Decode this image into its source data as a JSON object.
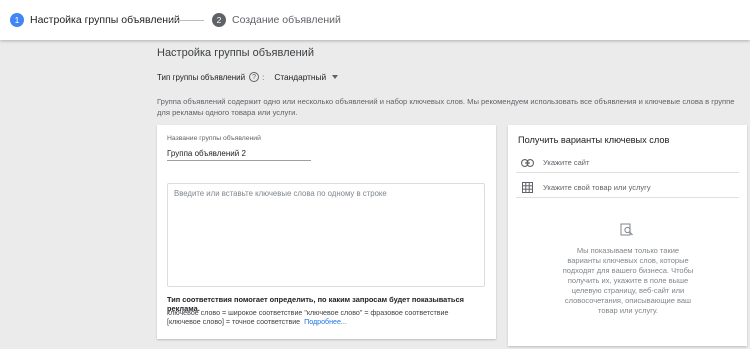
{
  "stepper": {
    "step1_number": "1",
    "step1_label": "Настройка группы объявлений",
    "step2_number": "2",
    "step2_label": "Создание объявлений",
    "active_color": "#4285f4"
  },
  "page": {
    "section_title": "Настройка группы объявлений",
    "type_label": "Тип группы объявлений",
    "type_help_icon": "help-circle-icon",
    "type_colon": ":",
    "type_value": "Стандартный",
    "description": "Группа объявлений содержит одно или несколько объявлений и набор ключевых слов. Мы рекомендуем использовать все объявления и ключевые слова в группе для рекламы одного товара или услуги."
  },
  "ad_group": {
    "name_label": "Название группы объявлений",
    "name_value": "Группа объявлений 2",
    "keywords_placeholder": "Введите или вставьте ключевые слова по одному в строке",
    "keywords_value": "",
    "match_title": "Тип соответствия помогает определить, по каким запросам будет показываться реклама.",
    "match_line1": "ключевое слово = широкое соответствие   \"ключевое слово\" = фразовое соответствие",
    "match_line2": "[ключевое слово] = точное соответствие",
    "more_link": "Подробнее..."
  },
  "keyword_ideas": {
    "title": "Получить варианты ключевых слов",
    "site_icon": "link-icon",
    "site_placeholder": "Укажите сайт",
    "product_icon": "product-grid-icon",
    "product_placeholder": "Укажите свой товар или услугу",
    "empty_icon": "search-document-icon",
    "empty_text": "Мы показываем только такие варианты ключевых слов, которые подходят для вашего бизнеса. Чтобы получить их, укажите в поле выше целевую страницу, веб-сайт или словосочетания, описывающие ваш товар или услугу."
  }
}
